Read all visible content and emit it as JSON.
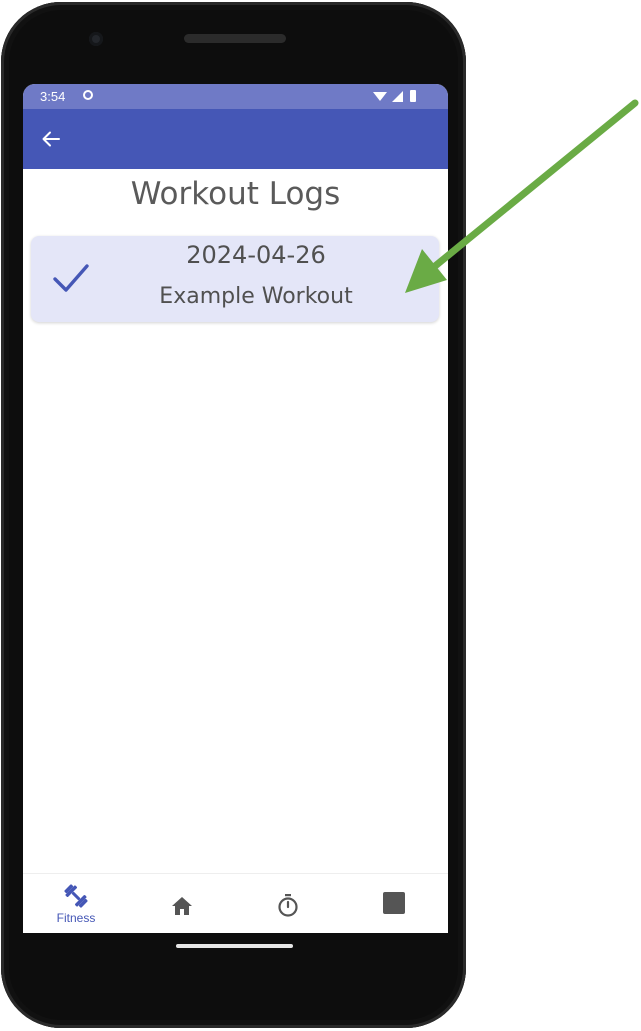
{
  "status_bar": {
    "time": "3:54",
    "notification_icon": "notification-circle-icon",
    "wifi_icon": "wifi-icon",
    "signal_icon": "cell-signal-icon",
    "battery_icon": "battery-icon",
    "background_color": "#6f7ac6"
  },
  "app_bar": {
    "back_icon": "arrow-back-icon",
    "background_color": "#4557b6"
  },
  "page": {
    "title": "Workout Logs"
  },
  "logs": [
    {
      "date": "2024-04-26",
      "name": "Example Workout",
      "status_icon": "check-icon"
    }
  ],
  "bottom_nav": {
    "items": [
      {
        "label": "Fitness",
        "icon": "dumbbell-icon",
        "selected": true
      },
      {
        "label": "",
        "icon": "home-icon",
        "selected": false
      },
      {
        "label": "",
        "icon": "timer-icon",
        "selected": false
      },
      {
        "label": "",
        "icon": "stop-square-icon",
        "selected": false
      }
    ],
    "accent_color": "#4557b6"
  },
  "annotation": {
    "arrow_color": "#6aab45",
    "points_to": "Example Workout"
  }
}
